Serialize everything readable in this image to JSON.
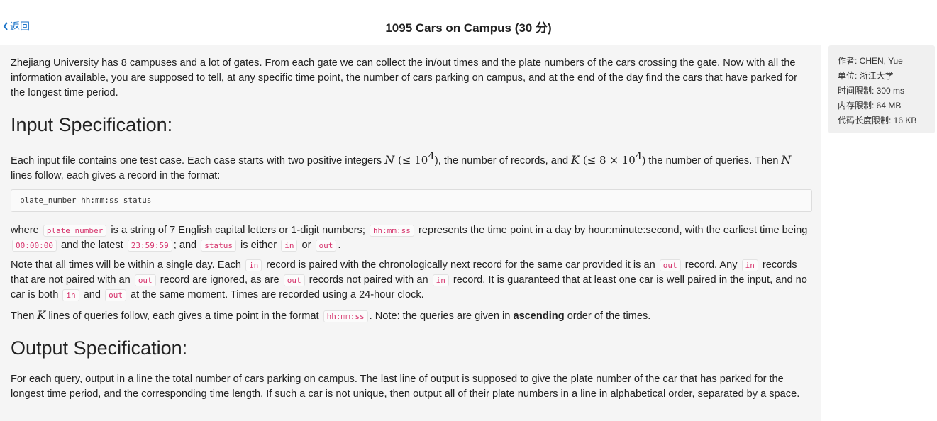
{
  "header": {
    "back_label": "返回",
    "title": "1095 Cars on Campus (30 分)"
  },
  "info": {
    "author": "作者: CHEN, Yue",
    "unit": "单位: 浙江大学",
    "time_limit": "时间限制: 300 ms",
    "memory_limit": "内存限制: 64 MB",
    "code_limit": "代码长度限制: 16 KB"
  },
  "problem": {
    "intro": "Zhejiang University has 8 campuses and a lot of gates. From each gate we can collect the in/out times and the plate numbers of the cars crossing the gate. Now with all the information available, you are supposed to tell, at any specific time point, the number of cars parking on campus, and at the end of the day find the cars that have parked for the longest time period.",
    "input_heading": "Input Specification:",
    "in1_a": "Each input file contains one test case. Each case starts with two positive integers ",
    "var_n": "N",
    "le": " (≤ 10",
    "exp4": "4",
    "in1_b": "), the number of records, and ",
    "var_k": "K",
    "le2": " (≤ 8 × 10",
    "in1_c": ") the number of queries. Then ",
    "in1_d": " lines follow, each gives a record in the format:",
    "format_line": "plate_number hh:mm:ss status",
    "w_where": "where ",
    "c_plate": "plate_number",
    "w_1": " is a string of 7 English capital letters or 1-digit numbers; ",
    "c_hms": "hh:mm:ss",
    "w_2": " represents the time point in a day by hour:minute:second, with the earliest time being ",
    "c_t0": "00:00:00",
    "w_3": " and the latest ",
    "c_t1": "23:59:59",
    "w_4": "; and ",
    "c_status": "status",
    "w_5": " is either ",
    "c_in": "in",
    "w_6": " or ",
    "c_out": "out",
    "w_7": ".",
    "n_1": "Note that all times will be within a single day. Each ",
    "n_2": " record is paired with the chronologically next record for the same car provided it is an ",
    "n_3": " record. Any ",
    "n_4": " records that are not paired with an ",
    "n_5": " record are ignored, as are ",
    "n_6": " records not paired with an ",
    "n_7": " record. It is guaranteed that at least one car is well paired in the input, and no car is both ",
    "n_8": " and ",
    "n_9": " at the same moment. Times are recorded using a 24-hour clock.",
    "q_1": "Then ",
    "q_2": " lines of queries follow, each gives a time point in the format ",
    "q_3": ". Note: the queries are given in ",
    "q_bold": "ascending",
    "q_4": " order of the times.",
    "output_heading": "Output Specification:",
    "output_text": "For each query, output in a line the total number of cars parking on campus. The last line of output is supposed to give the plate number of the car that has parked for the longest time period, and the corresponding time length. If such a car is not unique, then output all of their plate numbers in a line in alphabetical order, separated by a space."
  }
}
